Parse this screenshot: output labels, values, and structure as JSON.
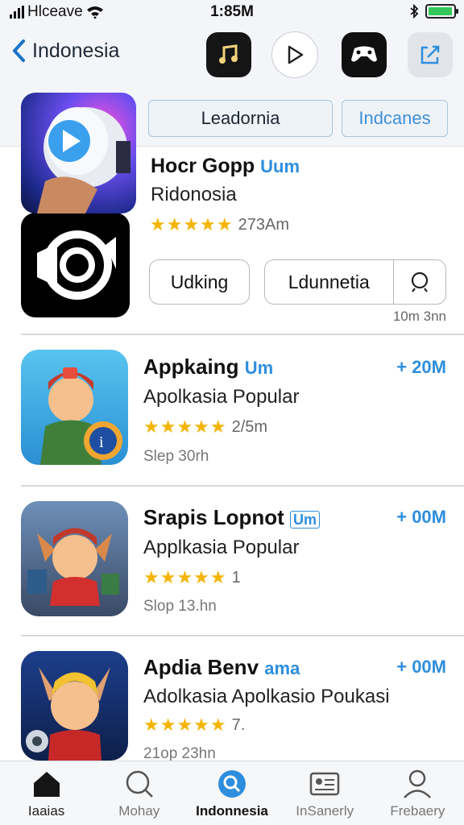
{
  "status_bar": {
    "carrier": "Hlceave",
    "time": "1:85M",
    "battery_level": 0.95
  },
  "nav": {
    "back_title": "Indonesia",
    "buttons": [
      "music-app-icon",
      "play-icon",
      "game-controller-icon",
      "share-edit-icon"
    ]
  },
  "segments": [
    "Leadornia",
    "Indcanes"
  ],
  "featured": {
    "title": "Hocr Gopp",
    "title_tag": "Uum",
    "subtitle": "Ridonosia",
    "rating": 5,
    "rating_text": "273Am",
    "button_1": "Udking",
    "button_2": "Ldunnetia",
    "meta": "10m 3nn"
  },
  "apps": [
    {
      "name": "Appkaing",
      "tag": "Um",
      "tag_style": "plain",
      "desc": "Apolkasia Popular",
      "rating": 5,
      "rating_text": "2/5m",
      "meta": "Slep 30rh",
      "price": "+ 20M"
    },
    {
      "name": "Srapis Lopnot",
      "tag": "Um",
      "tag_style": "box",
      "desc": "Applkasia Popular",
      "rating": 5,
      "rating_text": "1",
      "meta": "Slop 13.hn",
      "price": "+ 00M"
    },
    {
      "name": "Apdia Benv",
      "tag": "ama",
      "tag_style": "plain",
      "desc": "Adolkasia  Apolkasio Poukasi",
      "rating": 5,
      "rating_text": "7.",
      "meta": "21op 23hn",
      "price": "+ 00M"
    }
  ],
  "tabs": [
    {
      "label": "Iaaias",
      "icon": "home-icon",
      "active": false
    },
    {
      "label": "Mohay",
      "icon": "search-icon",
      "active": false
    },
    {
      "label": "Indonnesia",
      "icon": "explore-icon",
      "active": true
    },
    {
      "label": "InSanerly",
      "icon": "updates-icon",
      "active": false
    },
    {
      "label": "Frebaery",
      "icon": "profile-icon",
      "active": false
    }
  ],
  "colors": {
    "accent": "#2e8ede",
    "star": "#f4b400",
    "background": "#f3f5f8"
  }
}
